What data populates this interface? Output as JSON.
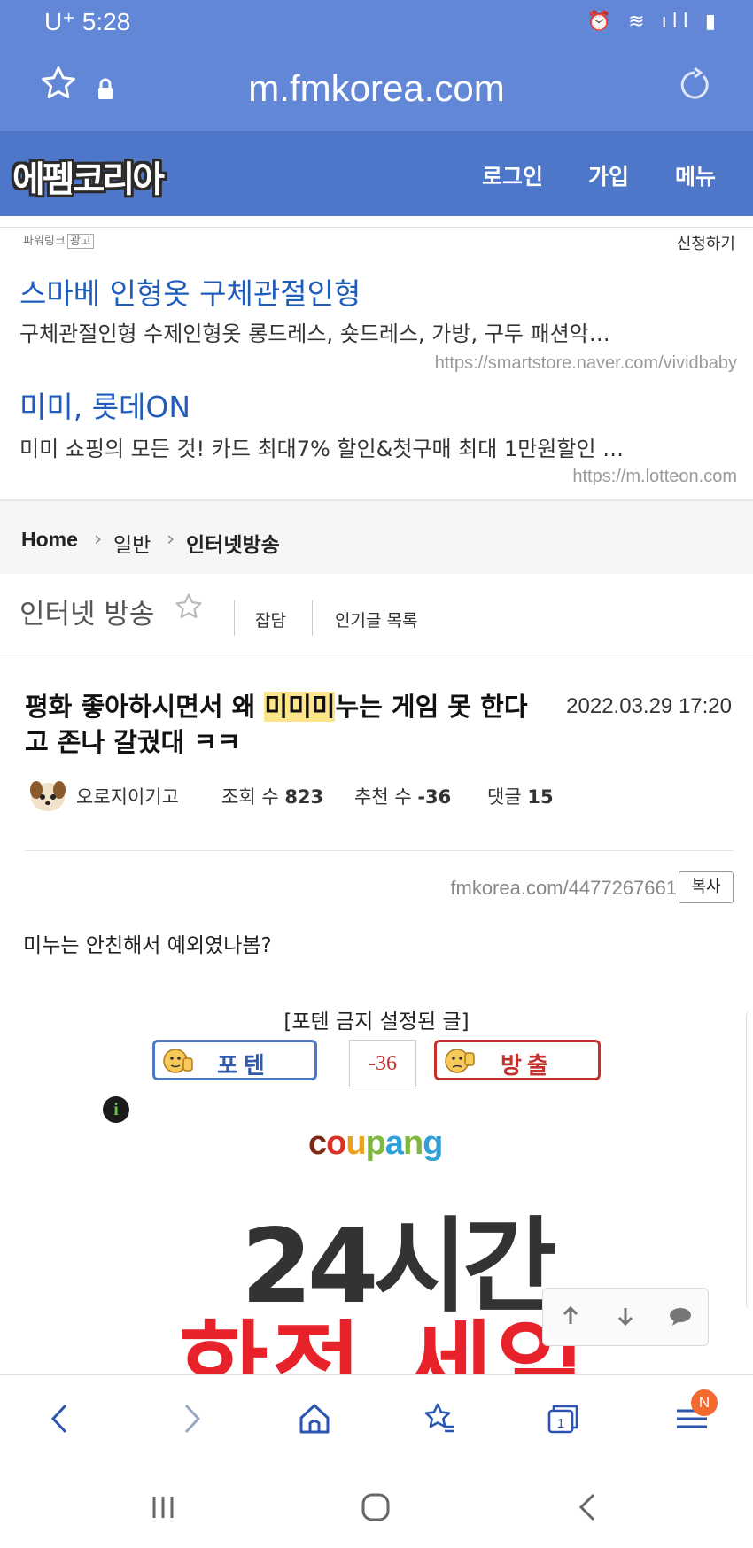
{
  "status": {
    "carrier": "U⁺ 5:28"
  },
  "browser": {
    "url": "m.fmkorea.com"
  },
  "site": {
    "logo_a": "에펨",
    "logo_b": "코리아",
    "nav": [
      "로그인",
      "가입",
      "메뉴"
    ]
  },
  "ads": {
    "label": "파워링크",
    "label_tag": "광고",
    "request": "신청하기",
    "items": [
      {
        "title": "스마베 인형옷 구체관절인형",
        "desc": "구체관절인형 수제인형옷 롱드레스, 숏드레스, 가방, 구두 패션악…",
        "url": "https://smartstore.naver.com/vividbaby"
      },
      {
        "title": "미미, 롯데ON",
        "desc": "미미 쇼핑의 모든 것! 카드 최대7% 할인&첫구매 최대 1만원할인 …",
        "url": "https://m.lotteon.com"
      }
    ]
  },
  "breadcrumb": [
    "Home",
    "일반",
    "인터넷방송"
  ],
  "board": {
    "title": "인터넷 방송",
    "links": [
      "잡담",
      "인기글 목록"
    ]
  },
  "post": {
    "title_pre": "평화 좋아하시면서 왜 ",
    "title_hl": "미미미",
    "title_post": "누는 게임 못 한다고 존나 갈궜대 ㅋㅋ",
    "date": "2022.03.29 17:20",
    "author": "오로지이기고",
    "views_label": "조회 수",
    "views": "823",
    "votes_label": "추천 수",
    "votes": "-36",
    "comments_label": "댓글",
    "comments": "15",
    "short_url": "fmkorea.com/4477267661",
    "copy_label": "복사",
    "body": "미누는 안친해서 예외였나봄?",
    "poten_notice": "[포텐 금지 설정된 글]",
    "poten_label": "포텐",
    "score": "-36",
    "bang_label": "방출"
  },
  "banner": {
    "brand": "coupang",
    "line1": "24시간",
    "line2": "한정 세일"
  },
  "bottom_nav": {
    "tab_count": "1",
    "badge": "N"
  }
}
